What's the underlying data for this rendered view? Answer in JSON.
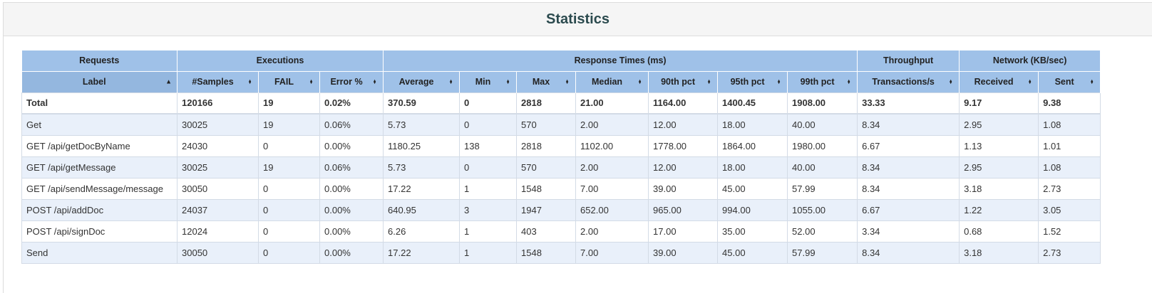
{
  "title": "Statistics",
  "groups": [
    "Requests",
    "Executions",
    "Response Times (ms)",
    "Throughput",
    "Network (KB/sec)"
  ],
  "columns": [
    "Label",
    "#Samples",
    "FAIL",
    "Error %",
    "Average",
    "Min",
    "Max",
    "Median",
    "90th pct",
    "95th pct",
    "99th pct",
    "Transactions/s",
    "Received",
    "Sent"
  ],
  "total": [
    "Total",
    "120166",
    "19",
    "0.02%",
    "370.59",
    "0",
    "2818",
    "21.00",
    "1164.00",
    "1400.45",
    "1908.00",
    "33.33",
    "9.17",
    "9.38"
  ],
  "rows": [
    [
      "Get",
      "30025",
      "19",
      "0.06%",
      "5.73",
      "0",
      "570",
      "2.00",
      "12.00",
      "18.00",
      "40.00",
      "8.34",
      "2.95",
      "1.08"
    ],
    [
      "GET /api/getDocByName",
      "24030",
      "0",
      "0.00%",
      "1180.25",
      "138",
      "2818",
      "1102.00",
      "1778.00",
      "1864.00",
      "1980.00",
      "6.67",
      "1.13",
      "1.01"
    ],
    [
      "GET /api/getMessage",
      "30025",
      "19",
      "0.06%",
      "5.73",
      "0",
      "570",
      "2.00",
      "12.00",
      "18.00",
      "40.00",
      "8.34",
      "2.95",
      "1.08"
    ],
    [
      "GET /api/sendMessage/message",
      "30050",
      "0",
      "0.00%",
      "17.22",
      "1",
      "1548",
      "7.00",
      "39.00",
      "45.00",
      "57.99",
      "8.34",
      "3.18",
      "2.73"
    ],
    [
      "POST /api/addDoc",
      "24037",
      "0",
      "0.00%",
      "640.95",
      "3",
      "1947",
      "652.00",
      "965.00",
      "994.00",
      "1055.00",
      "6.67",
      "1.22",
      "3.05"
    ],
    [
      "POST /api/signDoc",
      "12024",
      "0",
      "0.00%",
      "6.26",
      "1",
      "403",
      "2.00",
      "17.00",
      "35.00",
      "52.00",
      "3.34",
      "0.68",
      "1.52"
    ],
    [
      "Send",
      "30050",
      "0",
      "0.00%",
      "17.22",
      "1",
      "1548",
      "7.00",
      "39.00",
      "45.00",
      "57.99",
      "8.34",
      "3.18",
      "2.73"
    ]
  ]
}
